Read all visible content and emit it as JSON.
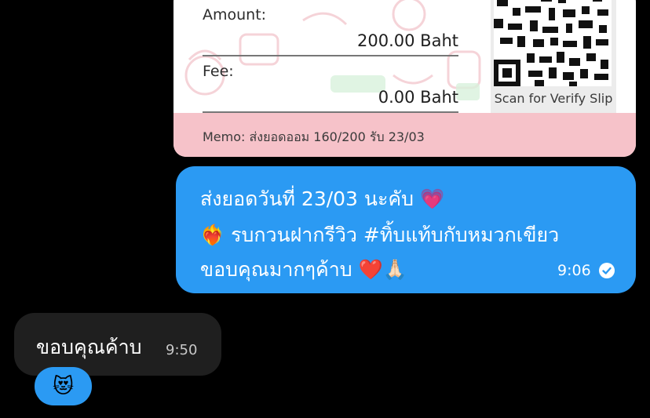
{
  "slip": {
    "amount_label": "Amount:",
    "amount_value": "200.00 Baht",
    "fee_label": "Fee:",
    "fee_value": "0.00 Baht",
    "qr_caption": "Scan for Verify Slip",
    "memo": "Memo: ส่งยอดออม 160/200 รับ 23/03"
  },
  "outgoing": {
    "line1": "ส่งยอดวันที่ 23/03 นะคับ 💗",
    "line2": "❤️‍🔥 รบกวนฝากรีวิว  #ทิ้บแท้บกับหมวกเขียว",
    "line3": "ขอบคุณมากๆค้าบ ❤️🙏🏻",
    "time": "9:06"
  },
  "incoming": {
    "text": "ขอบคุณค้าบ",
    "time": "9:50"
  },
  "reaction": {
    "emoji": "😻"
  },
  "colors": {
    "bubble_blue": "#2b9af3",
    "incoming_bg": "#1f1f1f",
    "memo_pink": "#f6c2c9"
  }
}
